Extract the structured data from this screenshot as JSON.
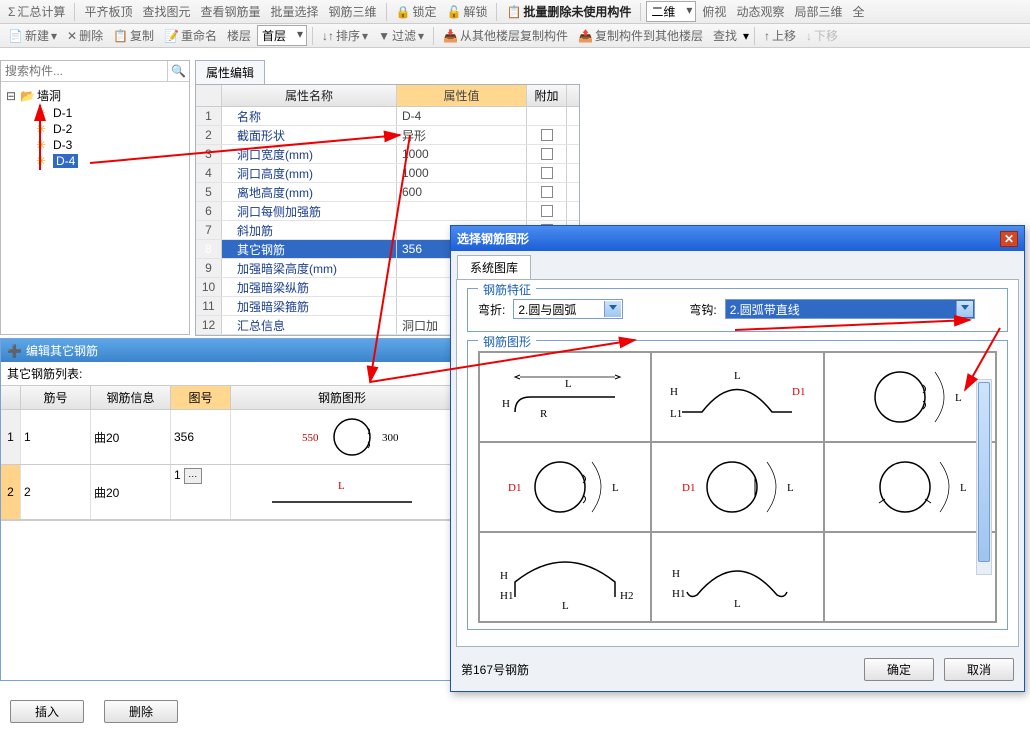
{
  "toolbar1": {
    "calc": "汇总计算",
    "flatten": "平齐板顶",
    "findElem": "查找图元",
    "viewRebar": "查看钢筋量",
    "batchSel": "批量选择",
    "rebar3d": "钢筋三维",
    "lock": "锁定",
    "unlock": "解锁",
    "batchDelUnused": "批量删除未使用构件",
    "view2d": "二维",
    "perspective": "俯视",
    "dynObs": "动态观察",
    "local3d": "局部三维",
    "viewAll": "全"
  },
  "toolbar2": {
    "new": "新建",
    "delete": "删除",
    "copy": "复制",
    "rename": "重命名",
    "floorLabel": "楼层",
    "floorValue": "首层",
    "sort": "排序",
    "filter": "过滤",
    "copyFromOther": "从其他楼层复制构件",
    "copyToOther": "复制构件到其他楼层",
    "find": "查找",
    "moveUp": "上移",
    "moveDown": "下移"
  },
  "search": {
    "placeholder": "搜索构件..."
  },
  "tree": {
    "root": "墙洞",
    "items": [
      "D-1",
      "D-2",
      "D-3",
      "D-4"
    ],
    "selected": "D-4"
  },
  "propTab": "属性编辑",
  "propHeaders": {
    "name": "属性名称",
    "value": "属性值",
    "add": "附加"
  },
  "propRows": [
    {
      "n": "1",
      "name": "名称",
      "val": "D-4",
      "chk": false
    },
    {
      "n": "2",
      "name": "截面形状",
      "val": "异形",
      "chk": true
    },
    {
      "n": "3",
      "name": "洞口宽度(mm)",
      "val": "1000",
      "chk": true
    },
    {
      "n": "4",
      "name": "洞口高度(mm)",
      "val": "1000",
      "chk": true
    },
    {
      "n": "5",
      "name": "离地高度(mm)",
      "val": "600",
      "chk": true
    },
    {
      "n": "6",
      "name": "洞口每侧加强筋",
      "val": "",
      "chk": true
    },
    {
      "n": "7",
      "name": "斜加筋",
      "val": "",
      "chk": true
    },
    {
      "n": "8",
      "name": "其它钢筋",
      "val": "356",
      "chk": true,
      "sel": true
    },
    {
      "n": "9",
      "name": "加强暗梁高度(mm)",
      "val": "",
      "chk": true
    },
    {
      "n": "10",
      "name": "加强暗梁纵筋",
      "val": "",
      "chk": true
    },
    {
      "n": "11",
      "name": "加强暗梁箍筋",
      "val": "",
      "chk": true
    },
    {
      "n": "12",
      "name": "汇总信息",
      "val": "洞口加",
      "chk": false
    }
  ],
  "editor": {
    "title": "编辑其它钢筋",
    "listLabel": "其它钢筋列表:",
    "headers": {
      "id": "筋号",
      "info": "钢筋信息",
      "diag": "图号",
      "shape": "钢筋图形"
    },
    "rows": [
      {
        "n": "1",
        "id": "1",
        "info": "曲20",
        "diag": "356",
        "dimL": "550",
        "dimR": "300"
      },
      {
        "n": "2",
        "id": "2",
        "info": "曲20",
        "diag": "1",
        "shapeLabel": "L"
      }
    ]
  },
  "bottomBtns": {
    "insert": "插入",
    "delete": "删除"
  },
  "dialog": {
    "title": "选择钢筋图形",
    "tab": "系统图库",
    "group1": "钢筋特征",
    "bendLabel": "弯折:",
    "bendValue": "2.圆与圆弧",
    "hookLabel": "弯钩:",
    "hookValue": "2.圆弧带直线",
    "group2": "钢筋图形",
    "shapeNo": "第167号钢筋",
    "ok": "确定",
    "cancel": "取消"
  }
}
